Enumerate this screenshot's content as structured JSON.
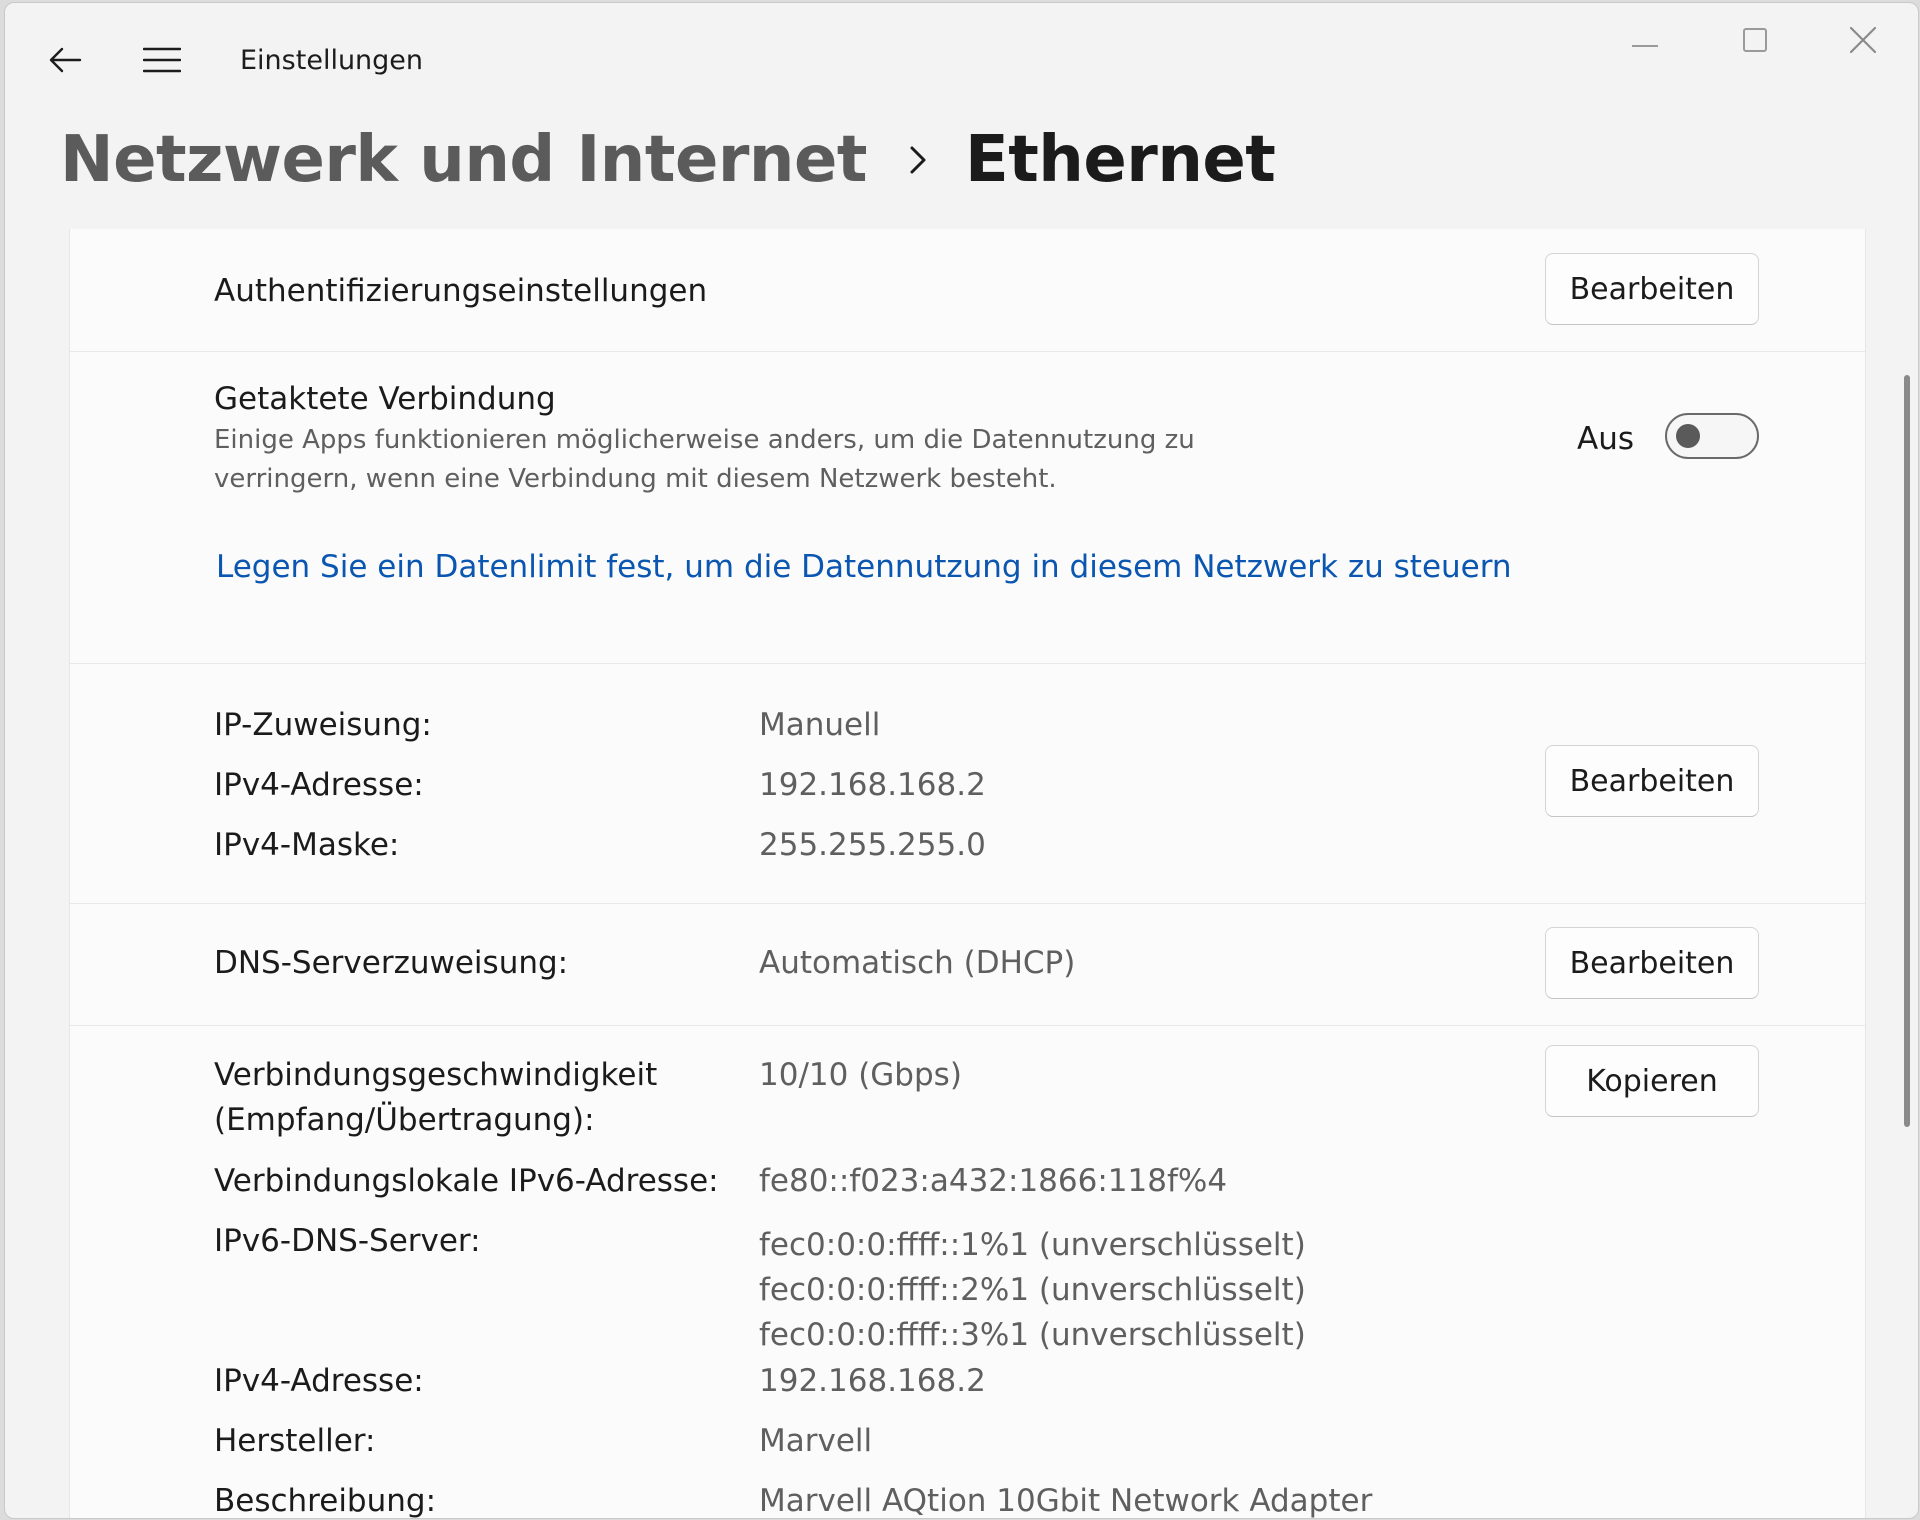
{
  "app": {
    "title": "Einstellungen"
  },
  "breadcrumb": {
    "parent": "Netzwerk und Internet",
    "current": "Ethernet"
  },
  "auth": {
    "label": "Authentifizierungseinstellungen",
    "button": "Bearbeiten"
  },
  "metered": {
    "title": "Getaktete Verbindung",
    "description_line1": "Einige Apps funktionieren möglicherweise anders, um die Datennutzung zu",
    "description_line2": "verringern, wenn eine Verbindung mit diesem Netzwerk besteht.",
    "toggle_state": "Aus",
    "toggle_on": false,
    "link": "Legen Sie ein Datenlimit fest, um die Datennutzung in diesem Netzwerk zu steuern"
  },
  "ip": {
    "assignment_label": "IP-Zuweisung:",
    "assignment_value": "Manuell",
    "ipv4_label": "IPv4-Adresse:",
    "ipv4_value": "192.168.168.2",
    "mask_label": "IPv4-Maske:",
    "mask_value": "255.255.255.0",
    "button": "Bearbeiten"
  },
  "dns": {
    "label": "DNS-Serverzuweisung:",
    "value": "Automatisch (DHCP)",
    "button": "Bearbeiten"
  },
  "props": {
    "speed_label_line1": "Verbindungsgeschwindigkeit",
    "speed_label_line2": "(Empfang/Übertragung):",
    "speed_value": "10/10 (Gbps)",
    "copy_button": "Kopieren",
    "linklocal_label": "Verbindungslokale IPv6-Adresse:",
    "linklocal_value": "fe80::f023:a432:1866:118f%4",
    "ipv6dns_label": "IPv6-DNS-Server:",
    "ipv6dns_values": [
      "fec0:0:0:ffff::1%1 (unverschlüsselt)",
      "fec0:0:0:ffff::2%1 (unverschlüsselt)",
      "fec0:0:0:ffff::3%1 (unverschlüsselt)"
    ],
    "ipv4_label": "IPv4-Adresse:",
    "ipv4_value": "192.168.168.2",
    "manufacturer_label": "Hersteller:",
    "manufacturer_value": "Marvell",
    "description_label": "Beschreibung:",
    "description_value": "Marvell AQtion 10Gbit Network Adapter"
  },
  "icons": {
    "back": "back-arrow-icon",
    "menu": "hamburger-menu-icon",
    "chevron": "chevron-right-icon",
    "minimize": "minimize-icon",
    "maximize": "maximize-icon",
    "close": "close-icon"
  }
}
